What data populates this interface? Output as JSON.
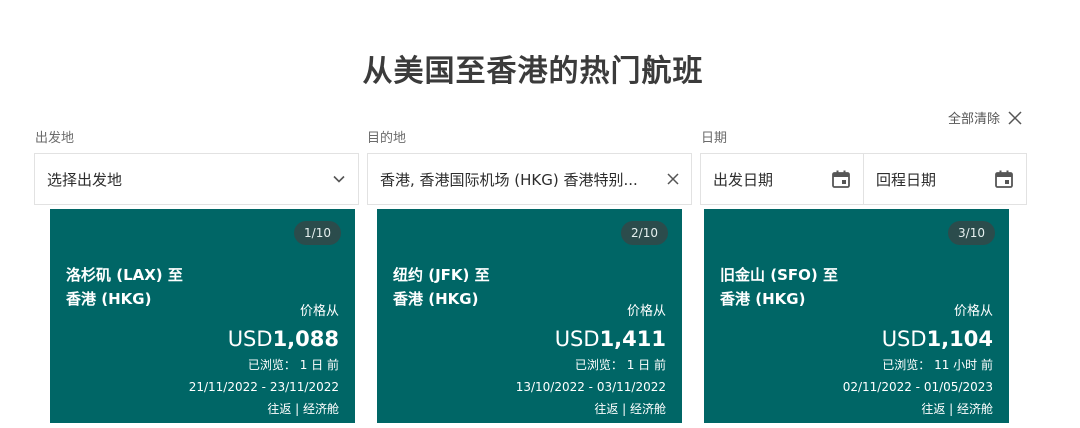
{
  "page": {
    "title": "从美国至香港的热门航班",
    "clear_all": "全部清除"
  },
  "search": {
    "origin": {
      "label": "出发地",
      "value": "选择出发地"
    },
    "destination": {
      "label": "目的地",
      "value": "香港, 香港国际机场 (HKG) 香港特别..."
    },
    "dates": {
      "label": "日期",
      "depart_placeholder": "出发日期",
      "return_placeholder": "回程日期"
    }
  },
  "cards": [
    {
      "counter": "1/10",
      "route_from": "洛杉矶 (LAX) 至",
      "route_to": "香港 (HKG)",
      "price_from_label": "价格从",
      "currency": "USD",
      "amount": "1,088",
      "viewed": "已浏览： 1 日 前",
      "dates": "21/11/2022 - 23/11/2022",
      "trip": "往返 | 经济舱"
    },
    {
      "counter": "2/10",
      "route_from": "纽约 (JFK) 至",
      "route_to": "香港 (HKG)",
      "price_from_label": "价格从",
      "currency": "USD",
      "amount": "1,411",
      "viewed": "已浏览： 1 日 前",
      "dates": "13/10/2022 - 03/11/2022",
      "trip": "往返 | 经济舱"
    },
    {
      "counter": "3/10",
      "route_from": "旧金山 (SFO) 至",
      "route_to": "香港 (HKG)",
      "price_from_label": "价格从",
      "currency": "USD",
      "amount": "1,104",
      "viewed": "已浏览： 11 小时 前",
      "dates": "02/11/2022 - 01/05/2023",
      "trip": "往返 | 经济舱"
    }
  ],
  "icons": {
    "clear_all": "close-icon",
    "origin_dropdown": "chevron-down-icon",
    "destination_clear": "close-icon",
    "date": "calendar-icon"
  },
  "colors": {
    "card_background": "#006666",
    "counter_background": "#2b4c4c",
    "icon_color": "#555555"
  }
}
